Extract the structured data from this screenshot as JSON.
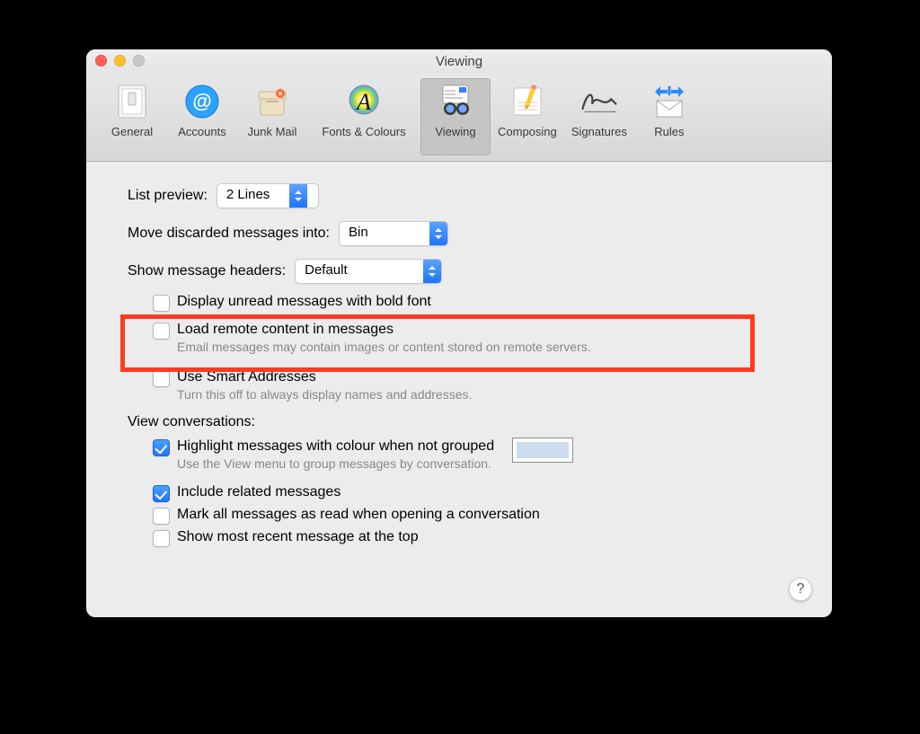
{
  "window": {
    "title": "Viewing"
  },
  "toolbar": {
    "items": [
      {
        "label": "General"
      },
      {
        "label": "Accounts"
      },
      {
        "label": "Junk Mail"
      },
      {
        "label": "Fonts & Colours"
      },
      {
        "label": "Viewing",
        "active": true
      },
      {
        "label": "Composing"
      },
      {
        "label": "Signatures"
      },
      {
        "label": "Rules"
      }
    ]
  },
  "content": {
    "list_preview": {
      "label": "List preview:",
      "value": "2 Lines"
    },
    "move_discarded": {
      "label": "Move discarded messages into:",
      "value": "Bin"
    },
    "show_headers": {
      "label": "Show message headers:",
      "value": "Default"
    },
    "display_unread": {
      "label": "Display unread messages with bold font",
      "checked": false
    },
    "load_remote": {
      "label": "Load remote content in messages",
      "hint": "Email messages may contain images or content stored on remote servers.",
      "checked": false
    },
    "smart_addresses": {
      "label": "Use Smart Addresses",
      "hint": "Turn this off to always display names and addresses.",
      "checked": false
    },
    "view_conversations_label": "View conversations:",
    "highlight_color": {
      "label": "Highlight messages with colour when not grouped",
      "hint": "Use the View menu to group messages by conversation.",
      "checked": true
    },
    "include_related": {
      "label": "Include related messages",
      "checked": true
    },
    "mark_read": {
      "label": "Mark all messages as read when opening a conversation",
      "checked": false
    },
    "recent_top": {
      "label": "Show most recent message at the top",
      "checked": false
    }
  },
  "help": {
    "symbol": "?"
  }
}
